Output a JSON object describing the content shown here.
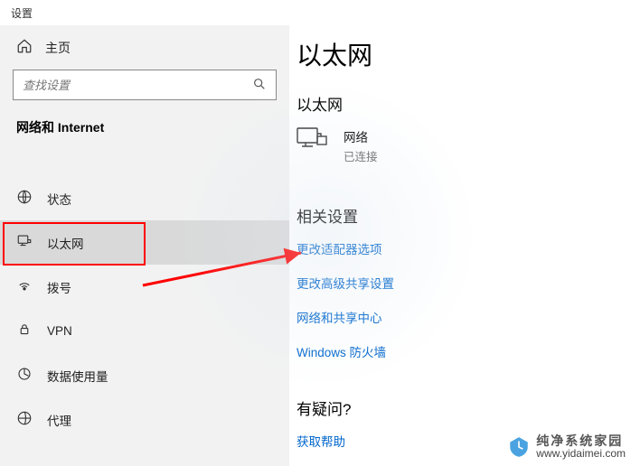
{
  "window": {
    "title": "设置"
  },
  "sidebar": {
    "home_label": "主页",
    "search_placeholder": "查找设置",
    "section_title": "网络和 Internet",
    "items": [
      {
        "label": "状态"
      },
      {
        "label": "以太网"
      },
      {
        "label": "拨号"
      },
      {
        "label": "VPN"
      },
      {
        "label": "数据使用量"
      },
      {
        "label": "代理"
      }
    ]
  },
  "main": {
    "page_title": "以太网",
    "network_section_title": "以太网",
    "network": {
      "name": "网络",
      "status": "已连接"
    },
    "related_title": "相关设置",
    "links": {
      "adapter": "更改适配器选项",
      "sharing": "更改高级共享设置",
      "center": "网络和共享中心",
      "firewall": "Windows 防火墙"
    },
    "help_title": "有疑问?",
    "help_link": "获取帮助"
  },
  "watermark": {
    "brand": "纯净系统家园",
    "url": "www.yidaimei.com"
  }
}
